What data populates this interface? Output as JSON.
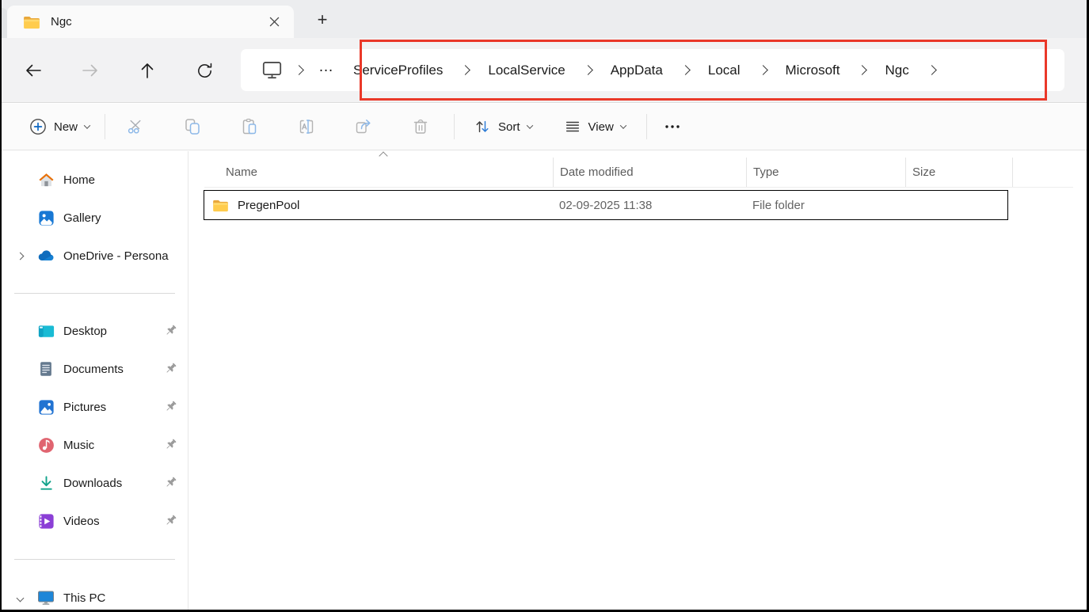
{
  "colors": {
    "annotation_red": "#EA3829",
    "accent_blue": "#0B66C2",
    "folder_yellow": "#FFC843",
    "toolbar_icon_blue": "#8CB8E8",
    "toolbar_icon_gray": "#b3b3b3"
  },
  "tab_bar": {
    "active_tab": {
      "label": "Ngc"
    },
    "new_tab_glyph": "+"
  },
  "navbar": {
    "breadcrumb": {
      "overflow_glyph": "…",
      "items": [
        "ServiceProfiles",
        "LocalService",
        "AppData",
        "Local",
        "Microsoft",
        "Ngc"
      ]
    }
  },
  "toolbar": {
    "new": {
      "label": "New"
    },
    "sort": {
      "label": "Sort"
    },
    "view": {
      "label": "View"
    }
  },
  "sidebar": {
    "items_top": [
      {
        "label": "Home"
      },
      {
        "label": "Gallery"
      },
      {
        "label": "OneDrive - Persona"
      }
    ],
    "items_pinned": [
      {
        "label": "Desktop"
      },
      {
        "label": "Documents"
      },
      {
        "label": "Pictures"
      },
      {
        "label": "Music"
      },
      {
        "label": "Downloads"
      },
      {
        "label": "Videos"
      }
    ],
    "items_bottom": [
      {
        "label": "This PC"
      }
    ]
  },
  "file_list": {
    "columns": [
      {
        "label": "Name"
      },
      {
        "label": "Date modified"
      },
      {
        "label": "Type"
      },
      {
        "label": "Size"
      }
    ],
    "rows": [
      {
        "name": "PregenPool",
        "date_modified": "02-09-2025 11:38",
        "type": "File folder",
        "size": ""
      }
    ]
  },
  "icons": {
    "tab-folder": "yellow folder",
    "close": "x cross",
    "device": "monitor",
    "breadcrumb-separator": "chevron-right",
    "back": "arrow-left",
    "forward": "arrow-right",
    "up": "arrow-up",
    "refresh": "circular-arrow",
    "new": "plus-circle",
    "cut": "scissors",
    "copy": "two-pages",
    "paste": "clipboard",
    "rename": "text-cursor",
    "share": "box-arrow",
    "delete": "trash-can",
    "sort": "up-down-arrows",
    "view": "list-lines",
    "more": "three-dots",
    "pin": "pushpin"
  }
}
